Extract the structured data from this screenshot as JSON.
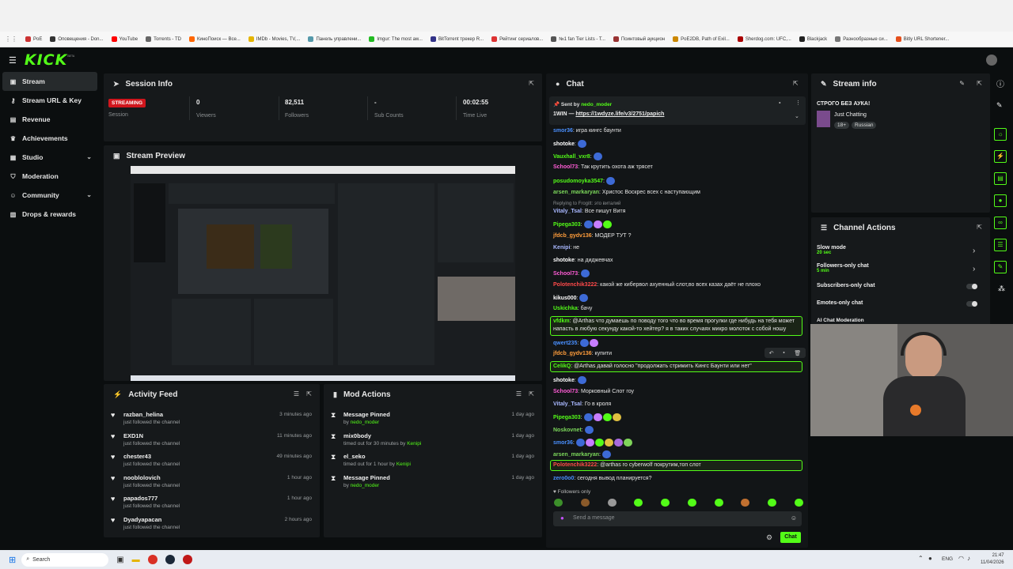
{
  "bookmarks": [
    "PoE",
    "Оповещения - Don...",
    "YouTube",
    "Torrents - TD",
    "КиноПоиск — Все...",
    "IMDb - Movies, TV,...",
    "Панель управлени...",
    "Imgur: The most aw...",
    "BitTorrent трекер R...",
    "Рейтинг сериалов...",
    "№1 fan Tier Lists - T...",
    "Поинтовый аукцион",
    "PoE2DB, Path of Exil...",
    "Sherdog.com: UFC,...",
    "Blackjack",
    "Разнообразные си...",
    "Bitly URL Shortener..."
  ],
  "brand": {
    "logo": "KICK",
    "beta": "BETA",
    "accent": "#53fc18"
  },
  "sidebar": {
    "items": [
      {
        "label": "Stream",
        "icon": "video-icon"
      },
      {
        "label": "Stream URL & Key",
        "icon": "key-icon"
      },
      {
        "label": "Revenue",
        "icon": "revenue-icon"
      },
      {
        "label": "Achievements",
        "icon": "trophy-icon"
      },
      {
        "label": "Studio",
        "icon": "studio-icon"
      },
      {
        "label": "Moderation",
        "icon": "shield-icon"
      },
      {
        "label": "Community",
        "icon": "people-icon"
      },
      {
        "label": "Drops & rewards",
        "icon": "gift-icon"
      }
    ]
  },
  "session": {
    "title": "Session Info",
    "status": "STREAMING",
    "session_label": "Session",
    "stats": [
      {
        "value": "0",
        "label": "Viewers"
      },
      {
        "value": "82,511",
        "label": "Followers"
      },
      {
        "value": "-",
        "label": "Sub Counts"
      },
      {
        "value": "00:02:55",
        "label": "Time Live"
      }
    ]
  },
  "preview": {
    "title": "Stream Preview"
  },
  "activity": {
    "title": "Activity Feed",
    "items": [
      {
        "name": "razban_helina",
        "text": "just followed the channel",
        "time": "3 minutes ago"
      },
      {
        "name": "EXD1N",
        "text": "just followed the channel",
        "time": "11 minutes ago"
      },
      {
        "name": "chester43",
        "text": "just followed the channel",
        "time": "49 minutes ago"
      },
      {
        "name": "nooblolovich",
        "text": "just followed the channel",
        "time": "1 hour ago"
      },
      {
        "name": "papados777",
        "text": "just followed the channel",
        "time": "1 hour ago"
      },
      {
        "name": "Dyadyapacan",
        "text": "just followed the channel",
        "time": "2 hours ago"
      }
    ]
  },
  "mod": {
    "title": "Mod Actions",
    "items": [
      {
        "title": "Message Pinned",
        "pre": "by ",
        "user": "nedo_moder",
        "post": "",
        "time": "1 day ago"
      },
      {
        "title": "mix0body",
        "pre": "timed out for 30 minutes by ",
        "user": "Kenipi",
        "post": "",
        "time": "1 day ago"
      },
      {
        "title": "el_seko",
        "pre": "timed out for 1 hour by ",
        "user": "Kenipi",
        "post": "",
        "time": "1 day ago"
      },
      {
        "title": "Message Pinned",
        "pre": "by ",
        "user": "nedo_moder",
        "post": "",
        "time": "1 day ago"
      }
    ]
  },
  "chat": {
    "title": "Chat",
    "pinned_by_label": "Sent by",
    "pinned_by": "nedo_moder",
    "pinned_text": "1WIN — ",
    "pinned_link": "https://1wdyze.life/v3/2751/papich",
    "reply_note": "Replying to Frogitt: это виталий",
    "messages": [
      {
        "user": "smor36",
        "color": "#4a90ff",
        "text": "игра кингс баунти",
        "emotes": 0
      },
      {
        "user": "shotoke",
        "color": "#ffffff",
        "text": "",
        "emotes": 1
      },
      {
        "user": "Vauxhall_vxr8",
        "color": "#53fc18",
        "text": "",
        "emotes": 1
      },
      {
        "user": "School73",
        "color": "#ff5cd6",
        "text": "Так крутить охота аж трясет",
        "emotes": 0
      },
      {
        "user": "posudomoyka3547",
        "color": "#53fc18",
        "text": "",
        "emotes": 1
      },
      {
        "user": "arsen_markaryan",
        "color": "#7bd65a",
        "text": "Христос Воскрес всех с наступающим",
        "emotes": 0
      },
      {
        "user": "Vitaly_Tsal",
        "color": "#a9b8ff",
        "text": "Все пишут Витя",
        "emotes": 0
      },
      {
        "user": "Pipega303",
        "color": "#53fc18",
        "text": "",
        "emotes": 3
      },
      {
        "user": "jfdcb_gydv136",
        "color": "#ff9d3b",
        "text": "МОДЕР ТУТ ?",
        "emotes": 0
      },
      {
        "user": "Kenipi",
        "color": "#a9b8ff",
        "text": "не",
        "emotes": 0
      },
      {
        "user": "shotoke",
        "color": "#ffffff",
        "text": "на диджевчах",
        "emotes": 0
      },
      {
        "user": "School73",
        "color": "#ff5cd6",
        "text": "",
        "emotes": 1
      },
      {
        "user": "Polotenchik3222",
        "color": "#ff4a4a",
        "text": "какой же кибервол ахуенный слот,во всех казах даёт не плохо",
        "emotes": 0
      },
      {
        "user": "kikus000",
        "color": "#ffffff",
        "text": "",
        "emotes": 1
      },
      {
        "user": "Uskichka",
        "color": "#53fc18",
        "text": "бачу",
        "emotes": 0
      }
    ],
    "highlight1": {
      "user": "vfdkm",
      "text": "@Arthas что думаешь по поводу того что во время прогулки где нибудь на тебя может",
      "text2": "напасть в любую секунду какой-то хейтер? я в таких случаях микро молоток с собой ношу"
    },
    "mid": [
      {
        "user": "qwert235",
        "color": "#4a90ff",
        "text": "",
        "emotes": 2
      },
      {
        "user": "jfdcb_gydv136",
        "color": "#ff9d3b",
        "text": "купити",
        "emotes": 0
      }
    ],
    "highlight2": {
      "user": "CelikQ",
      "text": "@Arthas давай голосно \"продолжать стримить Кингс Баунти или нет\""
    },
    "late": [
      {
        "user": "shotoke",
        "color": "#ffffff",
        "text": "",
        "emotes": 1
      },
      {
        "user": "School73",
        "color": "#ff5cd6",
        "text": "Морковный Слот гоу",
        "emotes": 0
      },
      {
        "user": "Vitaly_Tsal",
        "color": "#a9b8ff",
        "text": "Го в кроля",
        "emotes": 0
      },
      {
        "user": "Pipega303",
        "color": "#53fc18",
        "text": "",
        "emotes": 4
      },
      {
        "user": "Noskovnet",
        "color": "#7bd65a",
        "text": "",
        "emotes": 1
      },
      {
        "user": "smor36",
        "color": "#4a90ff",
        "text": "",
        "emotes": 6
      },
      {
        "user": "arsen_markaryan",
        "color": "#7bd65a",
        "text": "",
        "emotes": 1
      }
    ],
    "highlight3": {
      "user": "Polotenchik3222",
      "text": "@arthas го cyberwolf покрутим,топ слот"
    },
    "last": {
      "user": "zero0o0",
      "color": "#4a90ff",
      "text": "сегодня вывод планируется?"
    },
    "followers_only": "Followers only",
    "input_placeholder": "Send a message",
    "send_label": "Chat"
  },
  "stream_info": {
    "title": "Stream info",
    "stream_title": "СТРОГО БЕЗ АУКА!",
    "category": "Just Chatting",
    "tags": [
      "18+",
      "Russian"
    ]
  },
  "channel_actions": {
    "title": "Channel Actions",
    "items": [
      {
        "label": "Slow mode",
        "sub": "20 sec",
        "kind": "arrow"
      },
      {
        "label": "Followers-only chat",
        "sub": "5 min",
        "kind": "arrow"
      },
      {
        "label": "Subscribers-only chat",
        "sub": "",
        "kind": "toggle"
      },
      {
        "label": "Emotes-only chat",
        "sub": "",
        "kind": "toggle"
      }
    ],
    "ai_label": "AI Chat Moderation"
  },
  "taskbar": {
    "search": "Search",
    "lang": "ENG",
    "time": "21:47",
    "date": "11/04/2026"
  }
}
